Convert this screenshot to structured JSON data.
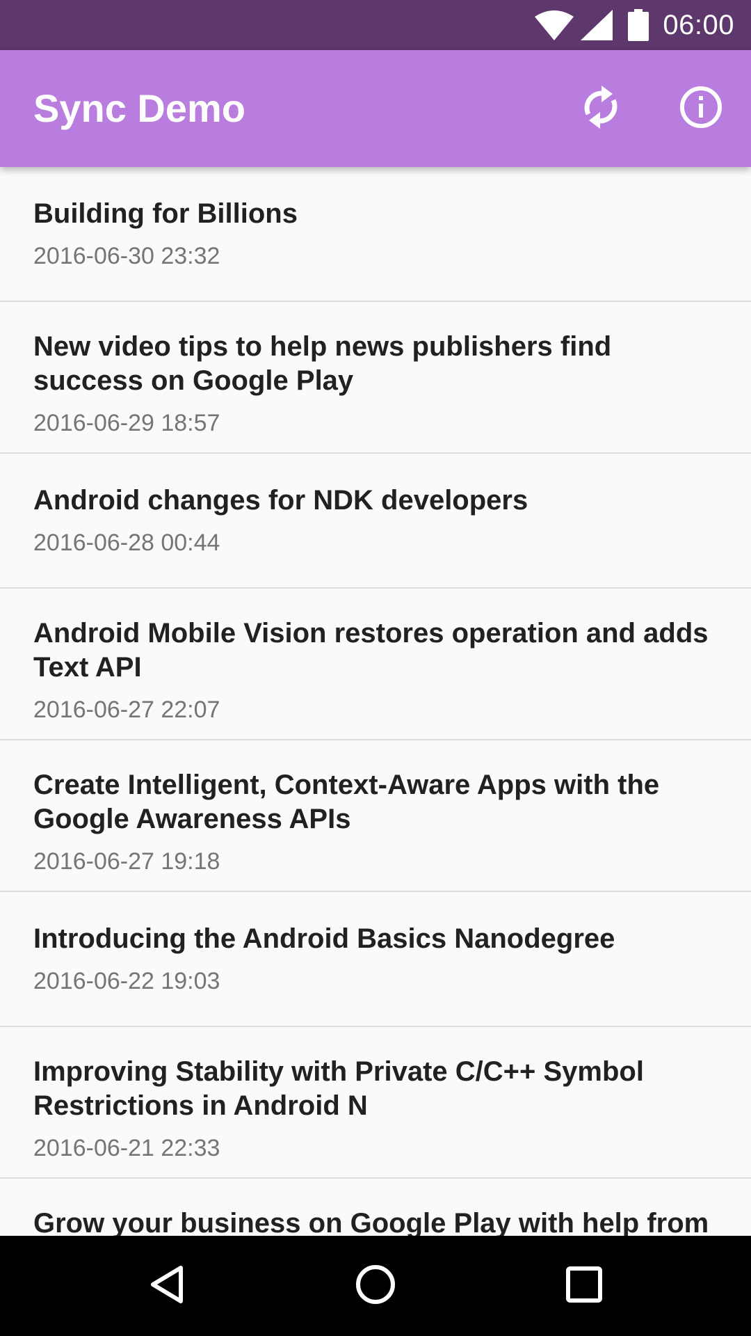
{
  "status_bar": {
    "time": "06:00",
    "icons": [
      "wifi-icon",
      "cell-signal-icon",
      "battery-icon"
    ]
  },
  "app_bar": {
    "title": "Sync Demo",
    "actions": [
      "sync-icon",
      "info-icon"
    ]
  },
  "articles": [
    {
      "title": "Building for Billions",
      "date": "2016-06-30 23:32"
    },
    {
      "title": "New video tips to help news publishers find success on Google Play",
      "date": "2016-06-29 18:57"
    },
    {
      "title": "Android changes for NDK developers",
      "date": "2016-06-28 00:44"
    },
    {
      "title": "Android Mobile Vision restores operation and adds Text API",
      "date": "2016-06-27 22:07"
    },
    {
      "title": "Create Intelligent, Context-Aware Apps with the Google Awareness APIs",
      "date": "2016-06-27 19:18"
    },
    {
      "title": "Introducing the Android Basics Nanodegree",
      "date": "2016-06-22 19:03"
    },
    {
      "title": "Improving Stability with Private C/C++ Symbol Restrictions in Android N",
      "date": "2016-06-21 22:33"
    },
    {
      "title": "Grow your business on Google Play with help from",
      "date": ""
    }
  ],
  "nav_bar": {
    "buttons": [
      "back-icon",
      "home-icon",
      "recents-icon"
    ]
  },
  "colors": {
    "status_bar": "#5e376c",
    "app_bar": "#b87ddf",
    "background": "#fafafa",
    "title_text": "#212121",
    "date_text": "#757575",
    "nav_bar": "#000000"
  }
}
